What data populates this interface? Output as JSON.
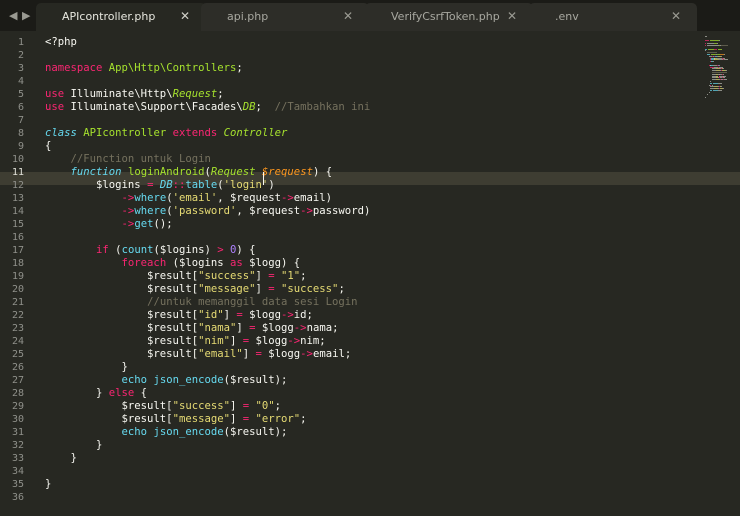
{
  "tabbar": {
    "nav_back": "◀",
    "nav_forward": "▶",
    "tabs": [
      {
        "label": "APIcontroller.php",
        "close": "✕",
        "active": true
      },
      {
        "label": "api.php",
        "close": "✕",
        "active": false
      },
      {
        "label": "VerifyCsrfToken.php",
        "close": "✕",
        "active": false
      },
      {
        "label": ".env",
        "close": "✕",
        "active": false
      }
    ]
  },
  "editor": {
    "current_line": 11,
    "lines": [
      [
        [
          "t-plain",
          "<?php"
        ]
      ],
      [],
      [
        [
          "t-kw",
          "namespace"
        ],
        [
          "t-plain",
          " "
        ],
        [
          "t-cl",
          "App\\Http\\Controllers"
        ],
        [
          "t-plain",
          ";"
        ]
      ],
      [],
      [
        [
          "t-kw",
          "use"
        ],
        [
          "t-plain",
          " Illuminate\\Http\\"
        ],
        [
          "t-cli",
          "Request"
        ],
        [
          "t-plain",
          ";"
        ]
      ],
      [
        [
          "t-kw",
          "use"
        ],
        [
          "t-plain",
          " Illuminate\\Support\\Facades\\"
        ],
        [
          "t-cli",
          "DB"
        ],
        [
          "t-plain",
          ";  "
        ],
        [
          "t-com",
          "//Tambahkan ini"
        ]
      ],
      [],
      [
        [
          "t-st",
          "class"
        ],
        [
          "t-plain",
          " "
        ],
        [
          "t-cl",
          "APIcontroller"
        ],
        [
          "t-plain",
          " "
        ],
        [
          "t-kw",
          "extends"
        ],
        [
          "t-plain",
          " "
        ],
        [
          "t-cli",
          "Controller"
        ]
      ],
      [
        [
          "t-plain",
          "{"
        ]
      ],
      [
        [
          "t-plain",
          "    "
        ],
        [
          "t-com",
          "//Function untuk Login"
        ]
      ],
      [
        [
          "t-plain",
          "    "
        ],
        [
          "t-st",
          "function"
        ],
        [
          "t-plain",
          " "
        ],
        [
          "t-fn",
          "loginAndroid"
        ],
        [
          "t-plain",
          "("
        ],
        [
          "t-cli",
          "Request"
        ],
        [
          "t-plain",
          " "
        ],
        [
          "t-var",
          "$request"
        ],
        [
          "t-plain",
          ") {"
        ]
      ],
      [
        [
          "t-plain",
          "        $logins "
        ],
        [
          "t-kw",
          "="
        ],
        [
          "t-plain",
          " "
        ],
        [
          "t-st",
          "DB"
        ],
        [
          "t-kw",
          "::"
        ],
        [
          "t-bi",
          "table"
        ],
        [
          "t-plain",
          "("
        ],
        [
          "t-str",
          "'login'"
        ],
        [
          "t-plain",
          ")"
        ]
      ],
      [
        [
          "t-plain",
          "            "
        ],
        [
          "t-kw",
          "->"
        ],
        [
          "t-bi",
          "where"
        ],
        [
          "t-plain",
          "("
        ],
        [
          "t-str",
          "'email'"
        ],
        [
          "t-plain",
          ", $request"
        ],
        [
          "t-kw",
          "->"
        ],
        [
          "t-plain",
          "email)"
        ]
      ],
      [
        [
          "t-plain",
          "            "
        ],
        [
          "t-kw",
          "->"
        ],
        [
          "t-bi",
          "where"
        ],
        [
          "t-plain",
          "("
        ],
        [
          "t-str",
          "'password'"
        ],
        [
          "t-plain",
          ", $request"
        ],
        [
          "t-kw",
          "->"
        ],
        [
          "t-plain",
          "password)"
        ]
      ],
      [
        [
          "t-plain",
          "            "
        ],
        [
          "t-kw",
          "->"
        ],
        [
          "t-bi",
          "get"
        ],
        [
          "t-plain",
          "();"
        ]
      ],
      [],
      [
        [
          "t-plain",
          "        "
        ],
        [
          "t-kw",
          "if"
        ],
        [
          "t-plain",
          " ("
        ],
        [
          "t-bi",
          "count"
        ],
        [
          "t-plain",
          "($logins) "
        ],
        [
          "t-kw",
          ">"
        ],
        [
          "t-plain",
          " "
        ],
        [
          "t-num",
          "0"
        ],
        [
          "t-plain",
          ") {"
        ]
      ],
      [
        [
          "t-plain",
          "            "
        ],
        [
          "t-kw",
          "foreach"
        ],
        [
          "t-plain",
          " ($logins "
        ],
        [
          "t-kw",
          "as"
        ],
        [
          "t-plain",
          " $logg) {"
        ]
      ],
      [
        [
          "t-plain",
          "                $result["
        ],
        [
          "t-str",
          "\"success\""
        ],
        [
          "t-plain",
          "] "
        ],
        [
          "t-kw",
          "="
        ],
        [
          "t-plain",
          " "
        ],
        [
          "t-str",
          "\"1\""
        ],
        [
          "t-plain",
          ";"
        ]
      ],
      [
        [
          "t-plain",
          "                $result["
        ],
        [
          "t-str",
          "\"message\""
        ],
        [
          "t-plain",
          "] "
        ],
        [
          "t-kw",
          "="
        ],
        [
          "t-plain",
          " "
        ],
        [
          "t-str",
          "\"success\""
        ],
        [
          "t-plain",
          ";"
        ]
      ],
      [
        [
          "t-plain",
          "                "
        ],
        [
          "t-com",
          "//untuk memanggil data sesi Login"
        ]
      ],
      [
        [
          "t-plain",
          "                $result["
        ],
        [
          "t-str",
          "\"id\""
        ],
        [
          "t-plain",
          "] "
        ],
        [
          "t-kw",
          "="
        ],
        [
          "t-plain",
          " $logg"
        ],
        [
          "t-kw",
          "->"
        ],
        [
          "t-plain",
          "id;"
        ]
      ],
      [
        [
          "t-plain",
          "                $result["
        ],
        [
          "t-str",
          "\"nama\""
        ],
        [
          "t-plain",
          "] "
        ],
        [
          "t-kw",
          "="
        ],
        [
          "t-plain",
          " $logg"
        ],
        [
          "t-kw",
          "->"
        ],
        [
          "t-plain",
          "nama;"
        ]
      ],
      [
        [
          "t-plain",
          "                $result["
        ],
        [
          "t-str",
          "\"nim\""
        ],
        [
          "t-plain",
          "] "
        ],
        [
          "t-kw",
          "="
        ],
        [
          "t-plain",
          " $logg"
        ],
        [
          "t-kw",
          "->"
        ],
        [
          "t-plain",
          "nim;"
        ]
      ],
      [
        [
          "t-plain",
          "                $result["
        ],
        [
          "t-str",
          "\"email\""
        ],
        [
          "t-plain",
          "] "
        ],
        [
          "t-kw",
          "="
        ],
        [
          "t-plain",
          " $logg"
        ],
        [
          "t-kw",
          "->"
        ],
        [
          "t-plain",
          "email;"
        ]
      ],
      [
        [
          "t-plain",
          "            }"
        ]
      ],
      [
        [
          "t-plain",
          "            "
        ],
        [
          "t-bi",
          "echo"
        ],
        [
          "t-plain",
          " "
        ],
        [
          "t-bi",
          "json_encode"
        ],
        [
          "t-plain",
          "($result);"
        ]
      ],
      [
        [
          "t-plain",
          "        } "
        ],
        [
          "t-kw",
          "else"
        ],
        [
          "t-plain",
          " {"
        ]
      ],
      [
        [
          "t-plain",
          "            $result["
        ],
        [
          "t-str",
          "\"success\""
        ],
        [
          "t-plain",
          "] "
        ],
        [
          "t-kw",
          "="
        ],
        [
          "t-plain",
          " "
        ],
        [
          "t-str",
          "\"0\""
        ],
        [
          "t-plain",
          ";"
        ]
      ],
      [
        [
          "t-plain",
          "            $result["
        ],
        [
          "t-str",
          "\"message\""
        ],
        [
          "t-plain",
          "] "
        ],
        [
          "t-kw",
          "="
        ],
        [
          "t-plain",
          " "
        ],
        [
          "t-str",
          "\"error\""
        ],
        [
          "t-plain",
          ";"
        ]
      ],
      [
        [
          "t-plain",
          "            "
        ],
        [
          "t-bi",
          "echo"
        ],
        [
          "t-plain",
          " "
        ],
        [
          "t-bi",
          "json_encode"
        ],
        [
          "t-plain",
          "($result);"
        ]
      ],
      [
        [
          "t-plain",
          "        }"
        ]
      ],
      [
        [
          "t-plain",
          "    }"
        ]
      ],
      [],
      [
        [
          "t-plain",
          "}"
        ]
      ],
      []
    ]
  },
  "colors": {
    "background": "#272822",
    "tabbar": "#1b1b17",
    "line_highlight": "#3e3d32"
  }
}
